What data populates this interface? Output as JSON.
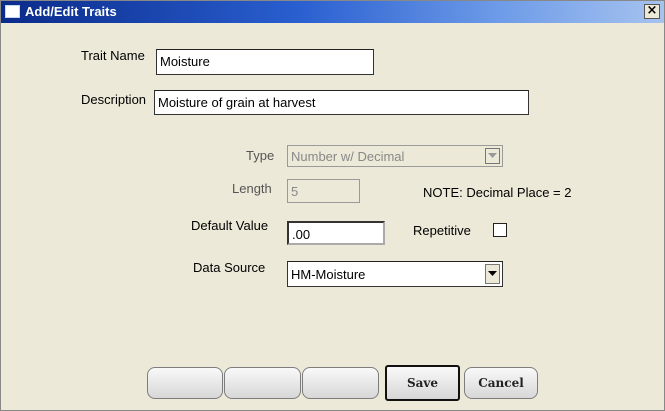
{
  "window": {
    "title": "Add/Edit Traits",
    "close_glyph": "×"
  },
  "fields": {
    "trait_name": {
      "label": "Trait Name",
      "value": "Moisture"
    },
    "description": {
      "label": "Description",
      "value": "Moisture of grain at harvest"
    },
    "type": {
      "label": "Type",
      "value": "Number w/ Decimal",
      "disabled": true
    },
    "length": {
      "label": "Length",
      "value": "5",
      "disabled": true
    },
    "note": "NOTE: Decimal Place = 2",
    "default_value": {
      "label": "Default Value",
      "value": ".00"
    },
    "repetitive": {
      "label": "Repetitive",
      "checked": false
    },
    "data_source": {
      "label": "Data Source",
      "value": "HM-Moisture"
    }
  },
  "buttons": {
    "blank1": "",
    "blank2": "",
    "blank3": "",
    "save": "Save",
    "cancel": "Cancel"
  },
  "icons": {
    "window_icon": "window-icon",
    "close": "close-icon",
    "dropdown": "chevron-down-icon"
  }
}
